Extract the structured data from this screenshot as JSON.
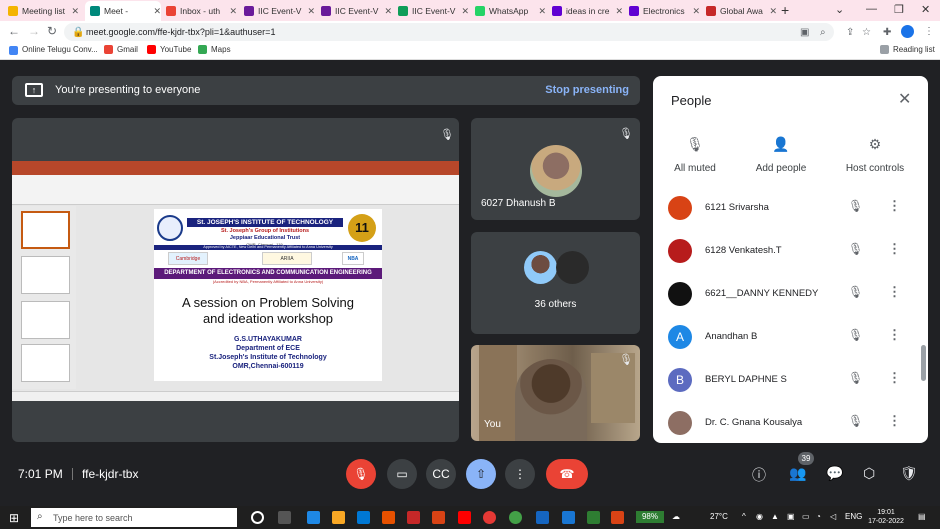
{
  "browser": {
    "tabs": [
      {
        "title": "Meeting list",
        "color": "#f4b400"
      },
      {
        "title": "Meet - ",
        "color": "#00897b",
        "active": true
      },
      {
        "title": "Inbox - uth",
        "color": "#ea4335"
      },
      {
        "title": "IIC Event-V",
        "color": "#6a1b9a"
      },
      {
        "title": "IIC Event-V",
        "color": "#6a1b9a"
      },
      {
        "title": "IIC Event-V",
        "color": "#0f9d58"
      },
      {
        "title": "WhatsApp",
        "color": "#25d366"
      },
      {
        "title": "ideas in cre",
        "color": "#6001d2"
      },
      {
        "title": "Electronics",
        "color": "#6001d2"
      },
      {
        "title": "Global Awa",
        "color": "#c62828"
      }
    ],
    "url": "meet.google.com/ffe-kjdr-tbx?pli=1&authuser=1",
    "bookmarks": [
      {
        "label": "Online Telugu Conv...",
        "color": "#1a73e8"
      },
      {
        "label": "Gmail",
        "color": "#ea4335"
      },
      {
        "label": "YouTube",
        "color": "#ff0000"
      },
      {
        "label": "Maps",
        "color": "#34a853"
      }
    ],
    "reading_list": "Reading list"
  },
  "presenting": {
    "text": "You're presenting to everyone",
    "stop": "Stop presenting"
  },
  "slide": {
    "tagline": "We Study You Shine",
    "institute": "St. JOSEPH'S INSTITUTE OF TECHNOLOGY",
    "group": "St. Joseph's Group of Institutions",
    "trust": "Jeppiaar Educational Trust",
    "location": "OMR, Chennai - 119.",
    "approved": "Approved by AICTE, New Delhi and Permanently Affiliated to Anna University",
    "logos": [
      "Cambridge",
      "ARIIA",
      "NBA"
    ],
    "department": "DEPARTMENT OF ELECTRONICS AND COMMUNICATION ENGINEERING",
    "accreditation": "(Accredited by NBA, Permanently Affiliated to Anna University)",
    "session_line1": "A session on Problem Solving",
    "session_line2": "and ideation workshop",
    "speaker": "G.S.UTHAYAKUMAR",
    "dept": "Department of ECE",
    "college": "St.Joseph's Institute of Technology",
    "address": "OMR,Chennai-600119",
    "badge": "11"
  },
  "tiles": {
    "dhanush": "6027 Dhanush B",
    "others": "36 others",
    "you": "You"
  },
  "people": {
    "title": "People",
    "actions": [
      {
        "label": "All muted",
        "icon": "🎙"
      },
      {
        "label": "Add people",
        "icon": "👤"
      },
      {
        "label": "Host controls",
        "icon": "⚙"
      }
    ],
    "list": [
      {
        "name": "6121 Srivarsha",
        "initial": "",
        "color": "#d84315"
      },
      {
        "name": "6128 Venkatesh.T",
        "initial": "",
        "color": "#b71c1c"
      },
      {
        "name": "6621__DANNY KENNEDY",
        "initial": "",
        "color": "#111111"
      },
      {
        "name": "Anandhan B",
        "initial": "A",
        "color": "#1e88e5"
      },
      {
        "name": "BERYL DAPHNE S",
        "initial": "B",
        "color": "#5c6bc0"
      },
      {
        "name": "Dr. C. Gnana Kousalya",
        "initial": "",
        "color": "#8d6e63"
      }
    ]
  },
  "bottom": {
    "time": "7:01 PM",
    "code": "ffe-kjdr-tbx",
    "participants_count": "39"
  },
  "taskbar": {
    "search_placeholder": "Type here to search",
    "battery": "98%",
    "temperature": "27°C",
    "lang": "ENG",
    "time": "19:01",
    "date": "17-02-2022"
  }
}
